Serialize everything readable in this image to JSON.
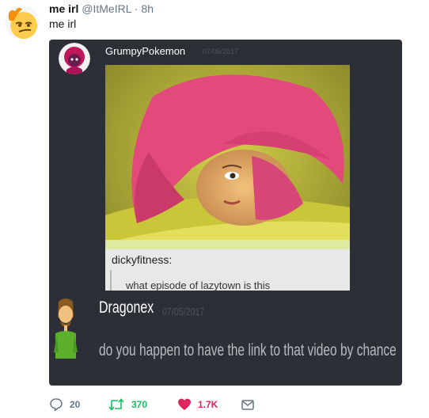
{
  "tweet": {
    "author_name": "me irl",
    "author_handle": "@ItMeIRL",
    "separator": "·",
    "time": "8h",
    "text": "me irl",
    "avatar_icon": "smirk-emoji-avatar"
  },
  "discord": {
    "message1": {
      "username": "GrumpyPokemon",
      "date": "07/05/2017",
      "avatar_icon": "pink-hair-avatar",
      "embed": {
        "caption_user": "dickyfitness:",
        "caption_quote": "what episode of lazytown is this"
      }
    },
    "message2": {
      "username": "Dragonex",
      "date": "07/05/2017",
      "text": "do you happen to have the link to that video by chance",
      "avatar_icon": "shaggy-avatar"
    }
  },
  "actions": {
    "reply_count": "20",
    "retweet_count": "370",
    "like_count": "1.7K"
  },
  "colors": {
    "retweet": "#17bf63",
    "like": "#e0245e",
    "muted": "#657786",
    "discord_bg": "#2c2f35"
  }
}
